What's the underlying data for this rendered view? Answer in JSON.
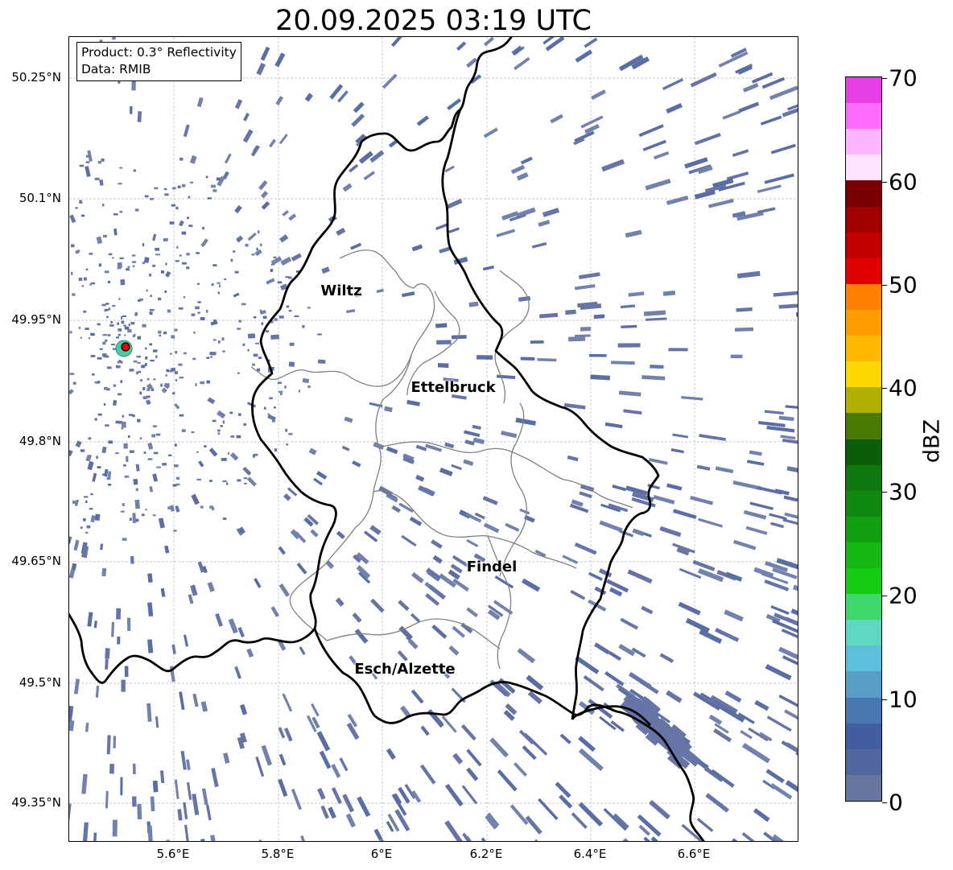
{
  "title": "20.09.2025 03:19 UTC",
  "info": {
    "product": "Product: 0.3° Reflectivity",
    "data": "Data: RMIB"
  },
  "axes": {
    "lat_ticks": [
      "50.25°N",
      "50.1°N",
      "49.95°N",
      "49.8°N",
      "49.65°N",
      "49.5°N",
      "49.35°N"
    ],
    "lon_ticks": [
      "5.6°E",
      "5.8°E",
      "6°E",
      "6.2°E",
      "6.4°E",
      "6.6°E"
    ],
    "grid": true
  },
  "cities": [
    {
      "name": "Wiltz"
    },
    {
      "name": "Ettelbruck"
    },
    {
      "name": "Findel"
    },
    {
      "name": "Esch/Alzette"
    }
  ],
  "colorbar": {
    "label": "dBZ",
    "ticks": [
      "70",
      "60",
      "50",
      "40",
      "30",
      "20",
      "10",
      "0"
    ],
    "colors": [
      "#e83ee8",
      "#fd6cfd",
      "#ffb6ff",
      "#ffe3ff",
      "#780000",
      "#a00000",
      "#c20000",
      "#e00000",
      "#ff7f00",
      "#ff9c00",
      "#ffb800",
      "#ffd700",
      "#b0b000",
      "#4a7a06",
      "#0b5c0b",
      "#0d780d",
      "#0f8a0f",
      "#11a011",
      "#13b813",
      "#15cc15",
      "#3fd66b",
      "#5fd8c2",
      "#5cc0d8",
      "#579ec6",
      "#4877b2",
      "#415fa0",
      "#51669d",
      "#67769f"
    ]
  },
  "radar": {
    "site_marker": "red-dot"
  }
}
